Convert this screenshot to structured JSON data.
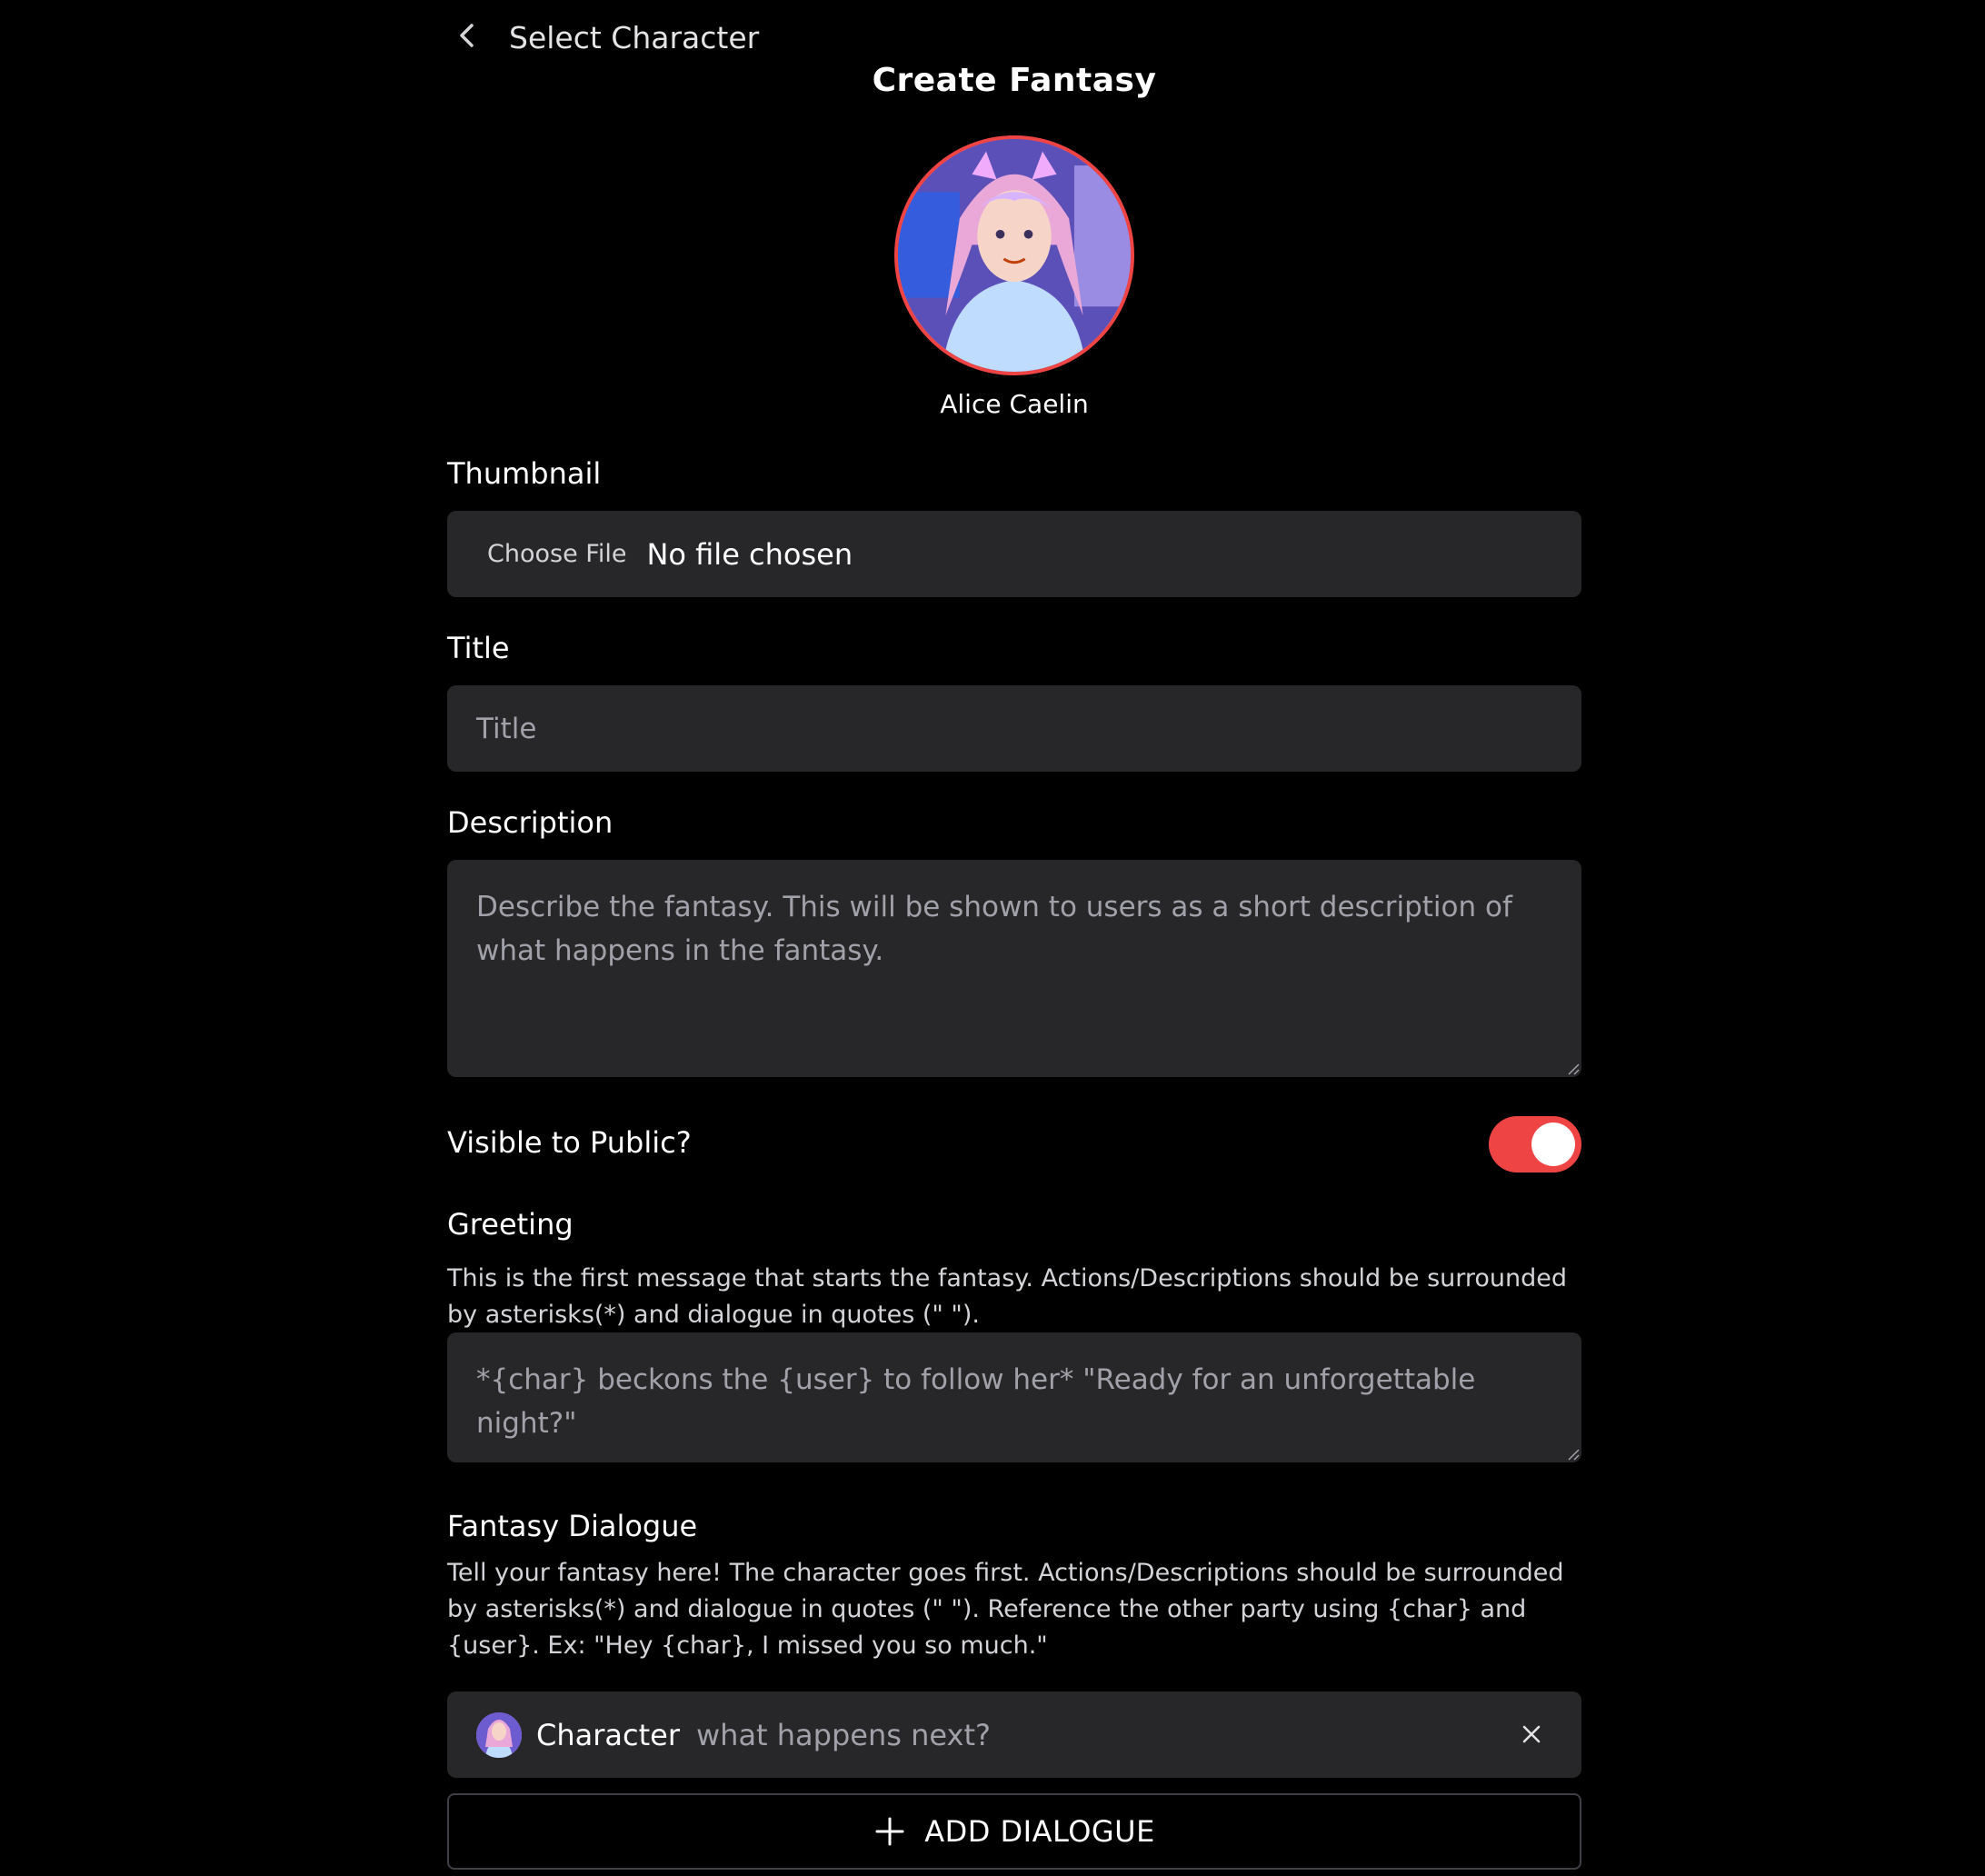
{
  "nav": {
    "back_label": "Select Character"
  },
  "header": {
    "title": "Create Fantasy"
  },
  "character": {
    "name": "Alice Caelin"
  },
  "form": {
    "thumbnail": {
      "label": "Thumbnail",
      "choose_label": "Choose File",
      "status": "No file chosen"
    },
    "title": {
      "label": "Title",
      "placeholder": "Title"
    },
    "description": {
      "label": "Description",
      "placeholder": "Describe the fantasy. This will be shown to users as a short description of what happens in the fantasy."
    },
    "visibility": {
      "label": "Visible to Public?",
      "enabled": true
    },
    "greeting": {
      "label": "Greeting",
      "help": "This is the first message that starts the fantasy. Actions/Descriptions should be surrounded by asterisks(*) and dialogue in quotes (\" \").",
      "placeholder": "*{char} beckons the {user} to follow her* \"Ready for an unforgettable night?\""
    },
    "dialogue": {
      "label": "Fantasy Dialogue",
      "help": "Tell your fantasy here! The character goes first. Actions/Descriptions should be surrounded by asterisks(*) and dialogue in quotes (\" \"). Reference the other party using {char} and {user}. Ex: \"Hey {char}, I missed you so much.\"",
      "entries": [
        {
          "role": "Character",
          "placeholder": "what happens next?"
        }
      ],
      "add_label": "ADD DIALOGUE"
    }
  },
  "colors": {
    "background": "#000000",
    "field_bg": "#27272a",
    "accent": "#ef4444",
    "muted_text": "#a1a1aa"
  }
}
